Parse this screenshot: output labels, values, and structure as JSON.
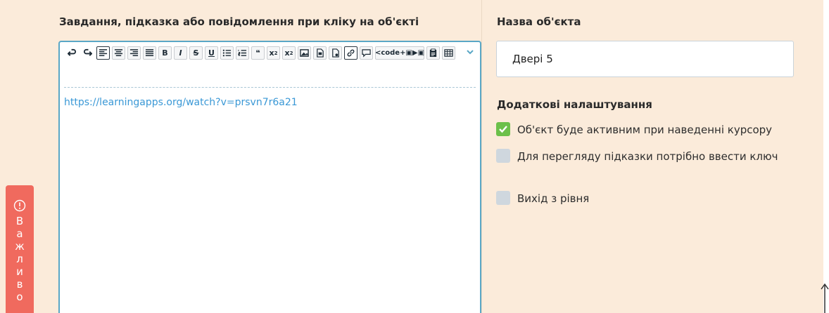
{
  "labels": {
    "task_label": "Завдання, підказка або повідомлення при кліку на об'єкті",
    "name_label": "Назва об'єкта",
    "extra_label": "Додаткові налаштування"
  },
  "editor": {
    "content": "https://learningapps.org/watch?v=prsvn7r6a21",
    "code_button_label": "<code+",
    "toolbar_tools": [
      "undo",
      "redo",
      "align-left",
      "align-center",
      "align-right",
      "justify",
      "bold",
      "italic",
      "strikethrough",
      "underline",
      "bullet-list",
      "numbered-list",
      "blockquote",
      "subscript",
      "superscript",
      "image",
      "file",
      "media",
      "link",
      "comment",
      "code",
      "paste",
      "table"
    ]
  },
  "name_field": {
    "value": "Двері 5"
  },
  "options": [
    {
      "label": "Об'єкт буде активним при наведенні курсору",
      "checked": true
    },
    {
      "label": "Для перегляду підказки потрібно ввести ключ",
      "checked": false
    },
    {
      "label": "Вихід з рівня",
      "checked": false
    }
  ],
  "side_alert": {
    "text": "Важливо"
  },
  "colors": {
    "panel_bg": "#fbebda",
    "accent_border": "#5aa7c6",
    "link": "#3a98d6",
    "checkbox_checked": "#6cc04a",
    "alert": "#f06a5e"
  }
}
